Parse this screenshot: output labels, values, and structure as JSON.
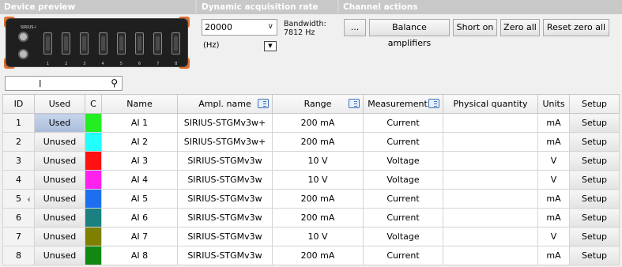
{
  "sections": {
    "device_preview": "Device preview",
    "rate": "Dynamic acquisition rate",
    "actions": "Channel actions"
  },
  "device": {
    "label": "SIRIUS-i",
    "connectors": [
      "1",
      "2",
      "3",
      "4",
      "5",
      "6",
      "7",
      "8"
    ]
  },
  "rate": {
    "value": "20000",
    "bandwidth_label": "Bandwidth:",
    "bandwidth_value": "7812 Hz",
    "unit": "(Hz)"
  },
  "actions": {
    "more": "...",
    "balance": "Balance amplifiers",
    "short": "Short on",
    "zero": "Zero all",
    "reset": "Reset zero all"
  },
  "search": {
    "value": ""
  },
  "table": {
    "headers": [
      "ID",
      "Used",
      "C",
      "Name",
      "Ampl. name",
      "Range",
      "Measurement",
      "Physical quantity",
      "Units",
      "Setup"
    ],
    "rows": [
      {
        "id": "1",
        "used": "Used",
        "color": "#22ee22",
        "name": "AI 1",
        "ampl": "SIRIUS-STGMv3w+",
        "range": "200 mA",
        "measurement": "Current",
        "pq": "",
        "units": "mA",
        "setup": "Setup"
      },
      {
        "id": "2",
        "used": "Unused",
        "color": "#22ffff",
        "name": "AI 2",
        "ampl": "SIRIUS-STGMv3w+",
        "range": "200 mA",
        "measurement": "Current",
        "pq": "",
        "units": "mA",
        "setup": "Setup"
      },
      {
        "id": "3",
        "used": "Unused",
        "color": "#ff1111",
        "name": "AI 3",
        "ampl": "SIRIUS-STGMv3w",
        "range": "10 V",
        "measurement": "Voltage",
        "pq": "",
        "units": "V",
        "setup": "Setup"
      },
      {
        "id": "4",
        "used": "Unused",
        "color": "#ff22ee",
        "name": "AI 4",
        "ampl": "SIRIUS-STGMv3w",
        "range": "10 V",
        "measurement": "Voltage",
        "pq": "",
        "units": "V",
        "setup": "Setup"
      },
      {
        "id": "5",
        "used": "Unused",
        "color": "#1e6ff0",
        "name": "AI 5",
        "ampl": "SIRIUS-STGMv3w",
        "range": "200 mA",
        "measurement": "Current",
        "pq": "",
        "units": "mA",
        "setup": "Setup"
      },
      {
        "id": "6",
        "used": "Unused",
        "color": "#1a8080",
        "name": "AI 6",
        "ampl": "SIRIUS-STGMv3w",
        "range": "200 mA",
        "measurement": "Current",
        "pq": "",
        "units": "mA",
        "setup": "Setup"
      },
      {
        "id": "7",
        "used": "Unused",
        "color": "#808000",
        "name": "AI 7",
        "ampl": "SIRIUS-STGMv3w",
        "range": "10 V",
        "measurement": "Voltage",
        "pq": "",
        "units": "V",
        "setup": "Setup"
      },
      {
        "id": "8",
        "used": "Unused",
        "color": "#118811",
        "name": "AI 8",
        "ampl": "SIRIUS-STGMv3w",
        "range": "200 mA",
        "measurement": "Current",
        "pq": "",
        "units": "mA",
        "setup": "Setup"
      }
    ]
  },
  "icons": {
    "search": "search-icon",
    "column_menu": "column-menu-icon",
    "dropdown": "chevron-down-icon"
  }
}
